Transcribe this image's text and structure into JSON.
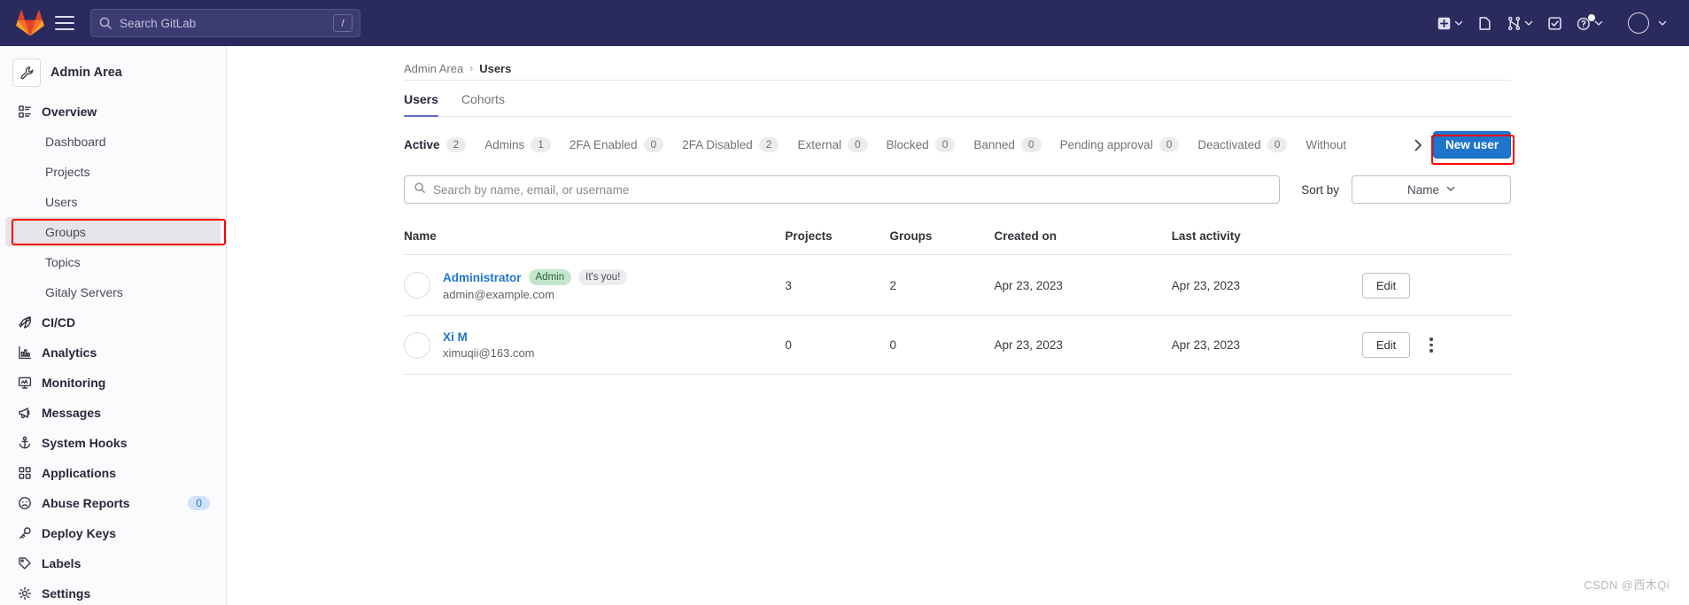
{
  "topnav": {
    "logo_icon": "gitlab-logo",
    "menu_icon": "hamburger-menu-icon",
    "search": {
      "icon": "search-icon",
      "placeholder": "Search GitLab",
      "shortcut_key": "/"
    },
    "actions": [
      {
        "name": "create-new-menu",
        "icon": "plus-square-icon",
        "chevron": true
      },
      {
        "name": "issues-link",
        "icon": "issues-icon",
        "chevron": false
      },
      {
        "name": "merge-requests-menu",
        "icon": "merge-request-icon",
        "chevron": true
      },
      {
        "name": "todos-link",
        "icon": "todo-check-icon",
        "chevron": false
      },
      {
        "name": "help-menu",
        "icon": "question-circle-icon",
        "chevron": true,
        "notification_dot": true
      },
      {
        "name": "user-menu",
        "icon": "avatar-circle-icon",
        "chevron": true
      }
    ]
  },
  "sidebar": {
    "context_title": "Admin Area",
    "context_icon": "wrench-icon",
    "items": [
      {
        "label": "Overview",
        "icon": "overview-icon",
        "level": "top",
        "state": "normal"
      },
      {
        "label": "Dashboard",
        "icon": "",
        "level": "sub",
        "state": "normal"
      },
      {
        "label": "Projects",
        "icon": "",
        "level": "sub",
        "state": "normal"
      },
      {
        "label": "Users",
        "icon": "",
        "level": "sub",
        "state": "annotated"
      },
      {
        "label": "Groups",
        "icon": "",
        "level": "sub",
        "state": "hovered"
      },
      {
        "label": "Topics",
        "icon": "",
        "level": "sub",
        "state": "normal"
      },
      {
        "label": "Gitaly Servers",
        "icon": "",
        "level": "sub",
        "state": "normal"
      },
      {
        "label": "CI/CD",
        "icon": "rocket-icon",
        "level": "top",
        "state": "normal"
      },
      {
        "label": "Analytics",
        "icon": "chart-icon",
        "level": "top",
        "state": "normal"
      },
      {
        "label": "Monitoring",
        "icon": "monitor-icon",
        "level": "top",
        "state": "normal"
      },
      {
        "label": "Messages",
        "icon": "megaphone-icon",
        "level": "top",
        "state": "normal"
      },
      {
        "label": "System Hooks",
        "icon": "anchor-icon",
        "level": "top",
        "state": "normal"
      },
      {
        "label": "Applications",
        "icon": "grid-squares-icon",
        "level": "top",
        "state": "normal"
      },
      {
        "label": "Abuse Reports",
        "icon": "sad-face-icon",
        "level": "top",
        "state": "normal",
        "count": "0"
      },
      {
        "label": "Deploy Keys",
        "icon": "key-icon",
        "level": "top",
        "state": "normal"
      },
      {
        "label": "Labels",
        "icon": "label-tag-icon",
        "level": "top",
        "state": "normal"
      },
      {
        "label": "Settings",
        "icon": "gear-icon",
        "level": "top",
        "state": "normal"
      }
    ]
  },
  "breadcrumb": {
    "parent": "Admin Area",
    "separator": "›",
    "current": "Users"
  },
  "page_tabs": [
    {
      "label": "Users",
      "active": true
    },
    {
      "label": "Cohorts",
      "active": false
    }
  ],
  "filters": [
    {
      "label": "Active",
      "count": "2",
      "active": true
    },
    {
      "label": "Admins",
      "count": "1",
      "active": false
    },
    {
      "label": "2FA Enabled",
      "count": "0",
      "active": false
    },
    {
      "label": "2FA Disabled",
      "count": "2",
      "active": false
    },
    {
      "label": "External",
      "count": "0",
      "active": false
    },
    {
      "label": "Blocked",
      "count": "0",
      "active": false
    },
    {
      "label": "Banned",
      "count": "0",
      "active": false
    },
    {
      "label": "Pending approval",
      "count": "0",
      "active": false
    },
    {
      "label": "Deactivated",
      "count": "0",
      "active": false
    },
    {
      "label": "Without",
      "count": "",
      "active": false
    }
  ],
  "filters_overflow_icon": "chevron-right-icon",
  "new_user_button": {
    "label": "New user",
    "color": "#1f75cb",
    "annotation_color": "#ff0000"
  },
  "search": {
    "placeholder": "Search by name, email, or username",
    "value": "",
    "icon": "search-icon"
  },
  "sort": {
    "label": "Sort by",
    "value": "Name",
    "chevron_icon": "chevron-down-icon"
  },
  "table": {
    "columns": [
      "Name",
      "Projects",
      "Groups",
      "Created on",
      "Last activity",
      ""
    ],
    "rows": [
      {
        "name": "Administrator",
        "email": "admin@example.com",
        "badges": [
          {
            "text": "Admin",
            "type": "admin"
          },
          {
            "text": "It's you!",
            "type": "you"
          }
        ],
        "projects": "3",
        "groups": "2",
        "created_on": "Apr 23, 2023",
        "last_activity": "Apr 23, 2023",
        "edit_label": "Edit",
        "has_kebab": false
      },
      {
        "name": "Xi M",
        "email": "ximuqii@163.com",
        "badges": [],
        "projects": "0",
        "groups": "0",
        "created_on": "Apr 23, 2023",
        "last_activity": "Apr 23, 2023",
        "edit_label": "Edit",
        "has_kebab": true
      }
    ]
  },
  "watermark": "CSDN @西木Qi"
}
